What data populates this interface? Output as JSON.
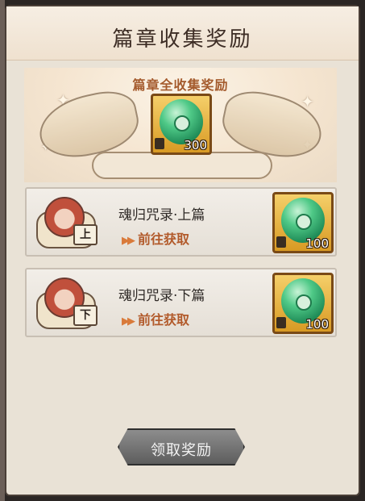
{
  "window": {
    "title": "篇章收集奖励"
  },
  "banner": {
    "title": "篇章全收集奖励",
    "reward": {
      "icon": "jade-magatama-icon",
      "count": "300"
    }
  },
  "chapters": [
    {
      "name": "魂归咒录·上篇",
      "tag": "上",
      "action": "前往获取",
      "reward": {
        "icon": "jade-magatama-icon",
        "count": "100"
      }
    },
    {
      "name": "魂归咒录·下篇",
      "tag": "下",
      "action": "前往获取",
      "reward": {
        "icon": "jade-magatama-icon",
        "count": "100"
      }
    }
  ],
  "claim_button": {
    "label": "领取奖励",
    "enabled": false
  },
  "colors": {
    "accent": "#b25a2b",
    "gold": "#d89a24",
    "jade": "#2fae6d"
  }
}
